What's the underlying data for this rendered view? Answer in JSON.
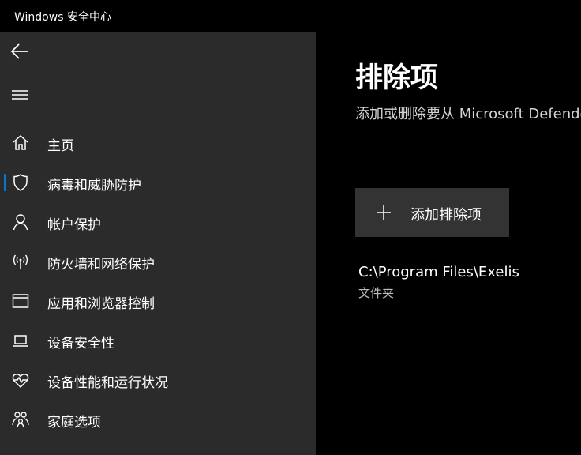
{
  "window": {
    "title": "Windows 安全中心"
  },
  "sidebar": {
    "items": [
      {
        "label": "主页",
        "icon": "home-icon"
      },
      {
        "label": "病毒和威胁防护",
        "icon": "shield-icon",
        "selected": true
      },
      {
        "label": "帐户保护",
        "icon": "person-icon"
      },
      {
        "label": "防火墙和网络保护",
        "icon": "antenna-icon"
      },
      {
        "label": "应用和浏览器控制",
        "icon": "browser-window-icon"
      },
      {
        "label": "设备安全性",
        "icon": "laptop-icon"
      },
      {
        "label": "设备性能和运行状况",
        "icon": "heart-pulse-icon"
      },
      {
        "label": "家庭选项",
        "icon": "family-icon"
      }
    ]
  },
  "main": {
    "title": "排除项",
    "description": "添加或删除要从 Microsoft Defender",
    "add_button_label": "添加排除项",
    "exclusions": [
      {
        "path": "C:\\Program Files\\Exelis",
        "type": "文件夹"
      }
    ]
  },
  "colors": {
    "accent": "#0078d7",
    "sidebar_bg": "#2b2b2b",
    "main_bg": "#000000",
    "button_bg": "#333333"
  }
}
